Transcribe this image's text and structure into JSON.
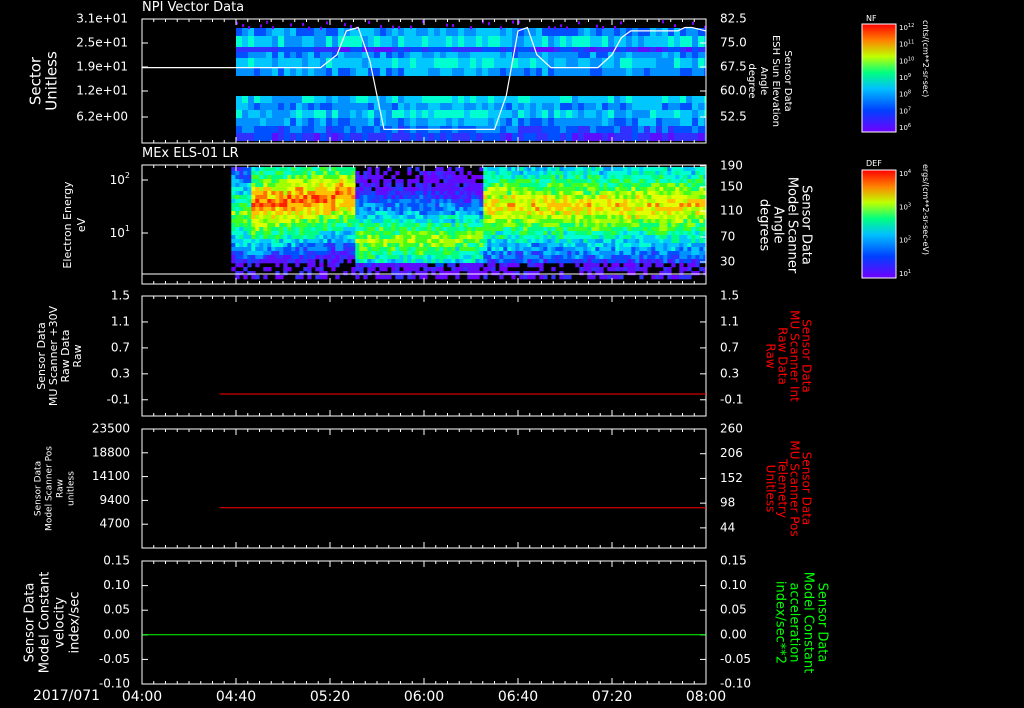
{
  "colors": {
    "background": "#000000",
    "axis": "#ffffff",
    "red_trace": "#ff0000",
    "green_trace": "#00ff00"
  },
  "footer": {
    "date_label": "2017/071",
    "time_ticks": [
      "04:00",
      "04:40",
      "05:20",
      "06:00",
      "06:40",
      "07:20",
      "08:00"
    ]
  },
  "chart_data": [
    {
      "type": "heatmap",
      "title": "NPI Vector Data",
      "ylabel": "Sector Unitless",
      "yticks": [
        "3.1e+01",
        "2.5e+01",
        "1.9e+01",
        "1.2e+01",
        "6.2e+00"
      ],
      "right_label": [
        "Sensor Data",
        "ESH Sun Elevation",
        "Angle",
        "degree"
      ],
      "right_ticks": [
        "82.5",
        "75.0",
        "67.5",
        "60.0",
        "52.5"
      ],
      "ylim_right": [
        46,
        82.5
      ],
      "x_start": "04:00",
      "x_end": "08:00",
      "data_start": "04:40",
      "overlay_line": {
        "name": "ESH Sun Elevation",
        "times": [
          "04:00",
          "05:16",
          "05:23",
          "05:27",
          "05:32",
          "05:37",
          "05:43",
          "06:30",
          "06:35",
          "06:40",
          "06:44",
          "06:48",
          "06:54",
          "07:14",
          "07:20",
          "07:24",
          "07:28",
          "07:44",
          "07:48",
          "07:51",
          "07:54",
          "08:00"
        ],
        "values": [
          68.2,
          68.2,
          72,
          79,
          80,
          70,
          50,
          50,
          60,
          79,
          80,
          72,
          68.2,
          68.2,
          72,
          77,
          79,
          79,
          79,
          80,
          80,
          79
        ]
      },
      "colorbar": {
        "label": "NF",
        "units": "cnts/(cm**2-sr-sec)",
        "ticks": [
          "10^12",
          "10^11",
          "10^10",
          "10^9",
          "10^8",
          "10^7",
          "10^6"
        ]
      }
    },
    {
      "type": "heatmap",
      "title": "MEx ELS-01 LR",
      "ylabel": "Electron Energy eV",
      "yticks": [
        "10^2",
        "10^1"
      ],
      "right_label": [
        "Sensor Data",
        "Model Scanner",
        "Angle",
        "degrees"
      ],
      "right_ticks": [
        "190",
        "150",
        "110",
        "70",
        "30"
      ],
      "ylim_right": [
        -5,
        190
      ],
      "x_start": "04:00",
      "x_end": "08:00",
      "data_start": "04:38",
      "overlay_line": {
        "name": "Model Scanner Angle",
        "value": 0
      },
      "colorbar": {
        "label": "DEF",
        "units": "ergs/(cm**2-sr-sec-eV)",
        "ticks": [
          "10^4",
          "10^3",
          "10^2",
          "10^1"
        ]
      }
    },
    {
      "type": "line",
      "ylabel": [
        "Sensor Data",
        "MU Scanner +30V",
        "Raw Data",
        "Raw"
      ],
      "yticks": [
        "1.5",
        "1.1",
        "0.7",
        "0.3",
        "-0.1"
      ],
      "ylim": [
        -0.35,
        1.5
      ],
      "right_label": [
        "Sensor Data",
        "MU Scanner Int",
        "Raw Data",
        "Raw"
      ],
      "right_ticks": [
        "1.5",
        "1.1",
        "0.7",
        "0.3",
        "-0.1"
      ],
      "series": [
        {
          "name": "MU Scanner Int",
          "x_start": "04:33",
          "x_end": "08:00",
          "value": -0.01
        }
      ]
    },
    {
      "type": "line",
      "ylabel": [
        "Sensor Data",
        "Model Scanner Pos",
        "Raw",
        "unitless"
      ],
      "yticks": [
        "23500",
        "18800",
        "14100",
        "9400",
        "4700"
      ],
      "ylim": [
        0,
        23500
      ],
      "right_label": [
        "Sensor Data",
        "MU Scanner Pos",
        "Telemetry",
        "Unitless"
      ],
      "right_ticks": [
        "260",
        "206",
        "152",
        "98",
        "44"
      ],
      "ylim_right": [
        0,
        260
      ],
      "series": [
        {
          "name": "MU Scanner Pos",
          "x_start": "04:33",
          "x_end": "08:00",
          "value": 88
        }
      ]
    },
    {
      "type": "line",
      "ylabel": [
        "Sensor Data",
        "Model Constant",
        "velocity",
        "index/sec"
      ],
      "yticks": [
        "0.15",
        "0.10",
        "0.05",
        "0.00",
        "-0.05",
        "-0.10"
      ],
      "ylim": [
        -0.1,
        0.15
      ],
      "right_label": [
        "Sensor Data",
        "Model Constant",
        "acceleration",
        "index/sec**2"
      ],
      "right_ticks": [
        "0.15",
        "0.10",
        "0.05",
        "0.00",
        "-0.05",
        "-0.10"
      ],
      "series": [
        {
          "name": "Model Constant",
          "x_start": "04:00",
          "x_end": "08:00",
          "value": 0.0
        }
      ]
    }
  ]
}
